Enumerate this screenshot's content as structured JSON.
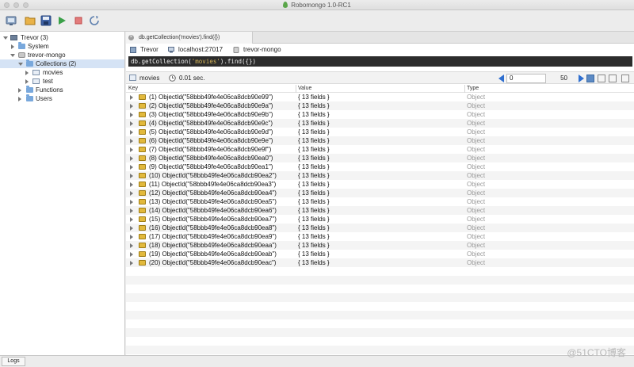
{
  "window": {
    "title": "Robomongo 1.0-RC1"
  },
  "toolbar": {
    "icons": [
      "connect-icon",
      "open-icon",
      "save-icon",
      "execute-icon",
      "stop-icon",
      "refresh-icon"
    ]
  },
  "sidebar": {
    "items": [
      {
        "label": "Trevor (3)"
      },
      {
        "label": "System"
      },
      {
        "label": "trevor-mongo"
      },
      {
        "label": "Collections (2)"
      },
      {
        "label": "movies"
      },
      {
        "label": "test"
      },
      {
        "label": "Functions"
      },
      {
        "label": "Users"
      }
    ]
  },
  "tab": {
    "label": "db.getCollection('movies').find({})",
    "close": "×"
  },
  "info": {
    "connection": "Trevor",
    "server": "localhost:27017",
    "database": "trevor-mongo"
  },
  "query": {
    "prefix": "db.getCollection(",
    "string": "'movies'",
    "suffix": ").find({})"
  },
  "results": {
    "collection": "movies",
    "time": "0.01 sec.",
    "skip": "0",
    "limit": "50",
    "columns": {
      "key": "Key",
      "value": "Value",
      "type": "Type"
    },
    "rows": [
      {
        "key": "(1) ObjectId(\"58bbb49fe4e06ca8dcb90e99\")",
        "value": "{ 13 fields }",
        "type": "Object"
      },
      {
        "key": "(2) ObjectId(\"58bbb49fe4e06ca8dcb90e9a\")",
        "value": "{ 13 fields }",
        "type": "Object"
      },
      {
        "key": "(3) ObjectId(\"58bbb49fe4e06ca8dcb90e9b\")",
        "value": "{ 13 fields }",
        "type": "Object"
      },
      {
        "key": "(4) ObjectId(\"58bbb49fe4e06ca8dcb90e9c\")",
        "value": "{ 13 fields }",
        "type": "Object"
      },
      {
        "key": "(5) ObjectId(\"58bbb49fe4e06ca8dcb90e9d\")",
        "value": "{ 13 fields }",
        "type": "Object"
      },
      {
        "key": "(6) ObjectId(\"58bbb49fe4e06ca8dcb90e9e\")",
        "value": "{ 13 fields }",
        "type": "Object"
      },
      {
        "key": "(7) ObjectId(\"58bbb49fe4e06ca8dcb90e9f\")",
        "value": "{ 13 fields }",
        "type": "Object"
      },
      {
        "key": "(8) ObjectId(\"58bbb49fe4e06ca8dcb90ea0\")",
        "value": "{ 13 fields }",
        "type": "Object"
      },
      {
        "key": "(9) ObjectId(\"58bbb49fe4e06ca8dcb90ea1\")",
        "value": "{ 13 fields }",
        "type": "Object"
      },
      {
        "key": "(10) ObjectId(\"58bbb49fe4e06ca8dcb90ea2\")",
        "value": "{ 13 fields }",
        "type": "Object"
      },
      {
        "key": "(11) ObjectId(\"58bbb49fe4e06ca8dcb90ea3\")",
        "value": "{ 13 fields }",
        "type": "Object"
      },
      {
        "key": "(12) ObjectId(\"58bbb49fe4e06ca8dcb90ea4\")",
        "value": "{ 13 fields }",
        "type": "Object"
      },
      {
        "key": "(13) ObjectId(\"58bbb49fe4e06ca8dcb90ea5\")",
        "value": "{ 13 fields }",
        "type": "Object"
      },
      {
        "key": "(14) ObjectId(\"58bbb49fe4e06ca8dcb90ea6\")",
        "value": "{ 13 fields }",
        "type": "Object"
      },
      {
        "key": "(15) ObjectId(\"58bbb49fe4e06ca8dcb90ea7\")",
        "value": "{ 13 fields }",
        "type": "Object"
      },
      {
        "key": "(16) ObjectId(\"58bbb49fe4e06ca8dcb90ea8\")",
        "value": "{ 13 fields }",
        "type": "Object"
      },
      {
        "key": "(17) ObjectId(\"58bbb49fe4e06ca8dcb90ea9\")",
        "value": "{ 13 fields }",
        "type": "Object"
      },
      {
        "key": "(18) ObjectId(\"58bbb49fe4e06ca8dcb90eaa\")",
        "value": "{ 13 fields }",
        "type": "Object"
      },
      {
        "key": "(19) ObjectId(\"58bbb49fe4e06ca8dcb90eab\")",
        "value": "{ 13 fields }",
        "type": "Object"
      },
      {
        "key": "(20) ObjectId(\"58bbb49fe4e06ca8dcb90eac\")",
        "value": "{ 13 fields }",
        "type": "Object"
      }
    ]
  },
  "logs": {
    "label": "Logs"
  },
  "watermark": "@51CTO博客",
  "colors": {
    "accent": "#5c8ac4",
    "queryBg": "#2c2c2c",
    "queryString": "#d7b65a",
    "selection": "#d5e3f5"
  }
}
